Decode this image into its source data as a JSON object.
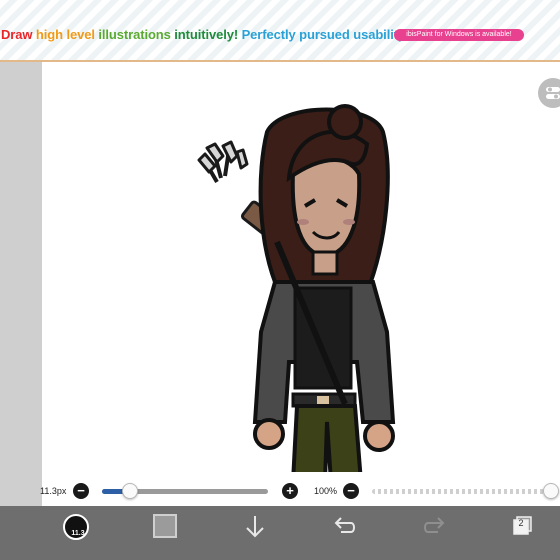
{
  "banner": {
    "segments": [
      {
        "text": "Draw ",
        "color": "#e8262a"
      },
      {
        "text": "high level ",
        "color": "#f09a17"
      },
      {
        "text": "illustrations ",
        "color": "#5aaa32"
      },
      {
        "text": "intuitively! ",
        "color": "#1e8c3a"
      },
      {
        "text": "Perfectly pursued usability!",
        "color": "#2aa1d6"
      }
    ],
    "pill_text": "ibisPaint for Windows is available!",
    "pill_color": "#e8418f"
  },
  "brush_slider": {
    "size_label": "11.3px",
    "minus": "−",
    "plus": "+",
    "value_fraction": 0.17
  },
  "opacity_slider": {
    "label": "100%",
    "minus": "−",
    "value_fraction": 1.0
  },
  "toolbar": {
    "brush_size": "11.3",
    "brush_color": "#111111",
    "fill_color": "#9b9b9b",
    "layer_count": "2",
    "icons": [
      "brush-icon",
      "color-swatch",
      "download-arrow-icon",
      "undo-icon",
      "redo-icon",
      "layers-icon"
    ]
  },
  "canvas": {
    "corner_icons": [
      "toggle-icon",
      "selection-icon"
    ]
  }
}
